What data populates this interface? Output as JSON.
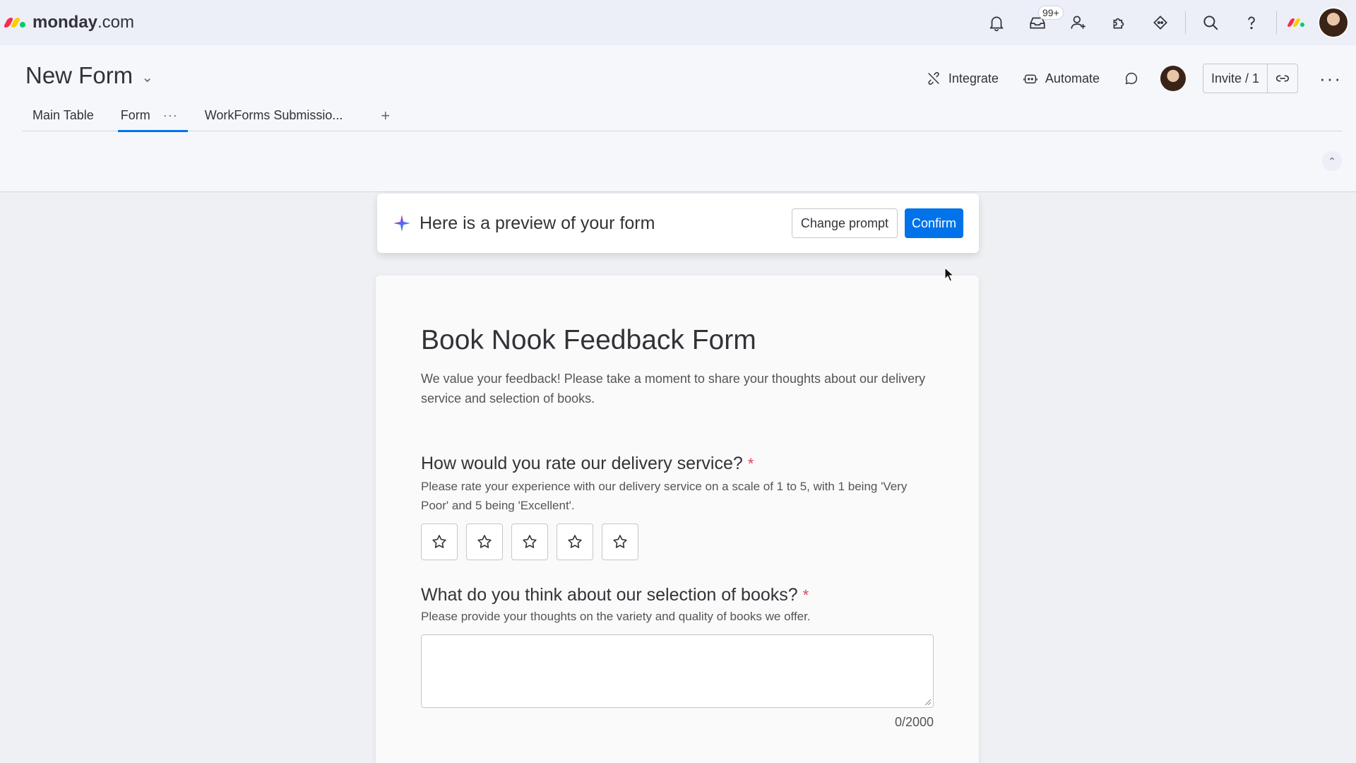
{
  "app": {
    "logo_bold": "monday",
    "logo_suffix": ".com",
    "notifications_badge": "99+"
  },
  "board": {
    "title": "New Form",
    "tabs": [
      {
        "label": "Main Table"
      },
      {
        "label": "Form",
        "more": "···"
      },
      {
        "label": "WorkForms Submissio..."
      }
    ],
    "add_tab": "+",
    "integrate_label": "Integrate",
    "automate_label": "Automate",
    "invite_label": "Invite / 1",
    "more_label": "···"
  },
  "preview": {
    "text": "Here is a preview of your form",
    "change_prompt_label": "Change prompt",
    "confirm_label": "Confirm"
  },
  "form": {
    "title": "Book Nook Feedback Form",
    "description": "We value your feedback! Please take a moment to share your thoughts about our delivery service and selection of books.",
    "questions": [
      {
        "title": "How would you rate our delivery service?",
        "required": "*",
        "help": "Please rate your experience with our delivery service on a scale of 1 to 5, with 1 being 'Very Poor' and 5 being 'Excellent'.",
        "type": "rating",
        "stars": 5
      },
      {
        "title": "What do you think about our selection of books?",
        "required": "*",
        "help": "Please provide your thoughts on the variety and quality of books we offer.",
        "type": "long-text",
        "counter": "0/2000"
      }
    ]
  },
  "colors": {
    "accent": "#0073ea",
    "required": "#e44258",
    "logo_red": "#f62b54",
    "logo_yellow": "#ffcc00",
    "logo_green": "#00ca72"
  }
}
